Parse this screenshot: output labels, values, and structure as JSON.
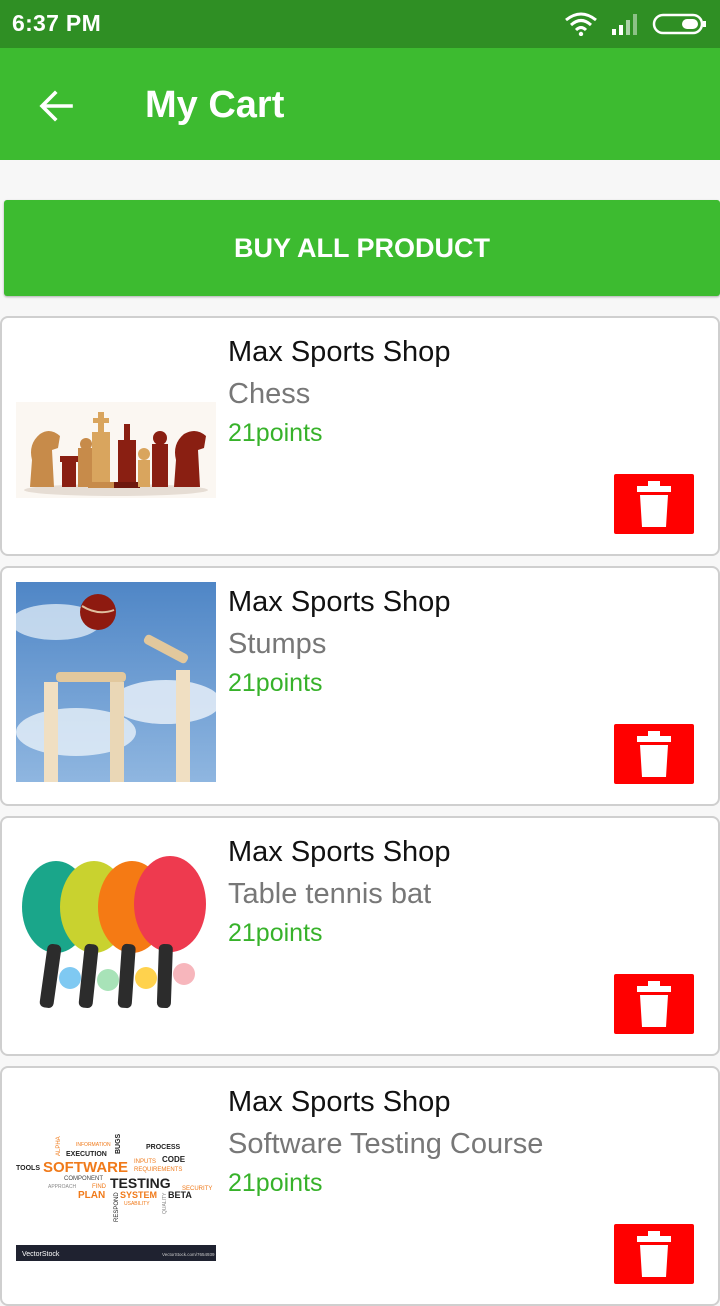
{
  "status_bar": {
    "time": "6:37 PM"
  },
  "app_bar": {
    "title": "My Cart"
  },
  "buy_button": {
    "label": "BUY ALL PRODUCT"
  },
  "items": [
    {
      "shop": "Max Sports Shop",
      "product": "Chess",
      "points": "21points"
    },
    {
      "shop": "Max Sports Shop",
      "product": "Stumps",
      "points": "21points"
    },
    {
      "shop": "Max Sports Shop",
      "product": "Table tennis bat",
      "points": "21points"
    },
    {
      "shop": "Max Sports Shop",
      "product": "Software Testing Course",
      "points": "21points"
    }
  ],
  "software_thumb": {
    "words": [
      "ALPHA",
      "INFORMATION",
      "BUGS",
      "PROCESS",
      "EXECUTION",
      "CODE",
      "INPUTS",
      "TOOLS",
      "SOFTWARE",
      "REQUIREMENTS",
      "COMPONENT",
      "APPROACH",
      "FIND",
      "TESTING",
      "PLAN",
      "SYSTEM",
      "SECURITY",
      "BETA",
      "RESPOND",
      "USABILITY",
      "QUALITY"
    ],
    "brand": "VectorStock",
    "brand_url": "VectorStock.com/7654939"
  },
  "colors": {
    "status_bar": "#2f8f24",
    "app_bar": "#3dbb30",
    "points": "#37b22a",
    "delete": "#ff0000"
  },
  "icons": {
    "back": "arrow-left-icon",
    "wifi": "wifi-icon",
    "signal": "signal-icon",
    "battery": "battery-icon",
    "delete": "trash-icon"
  }
}
